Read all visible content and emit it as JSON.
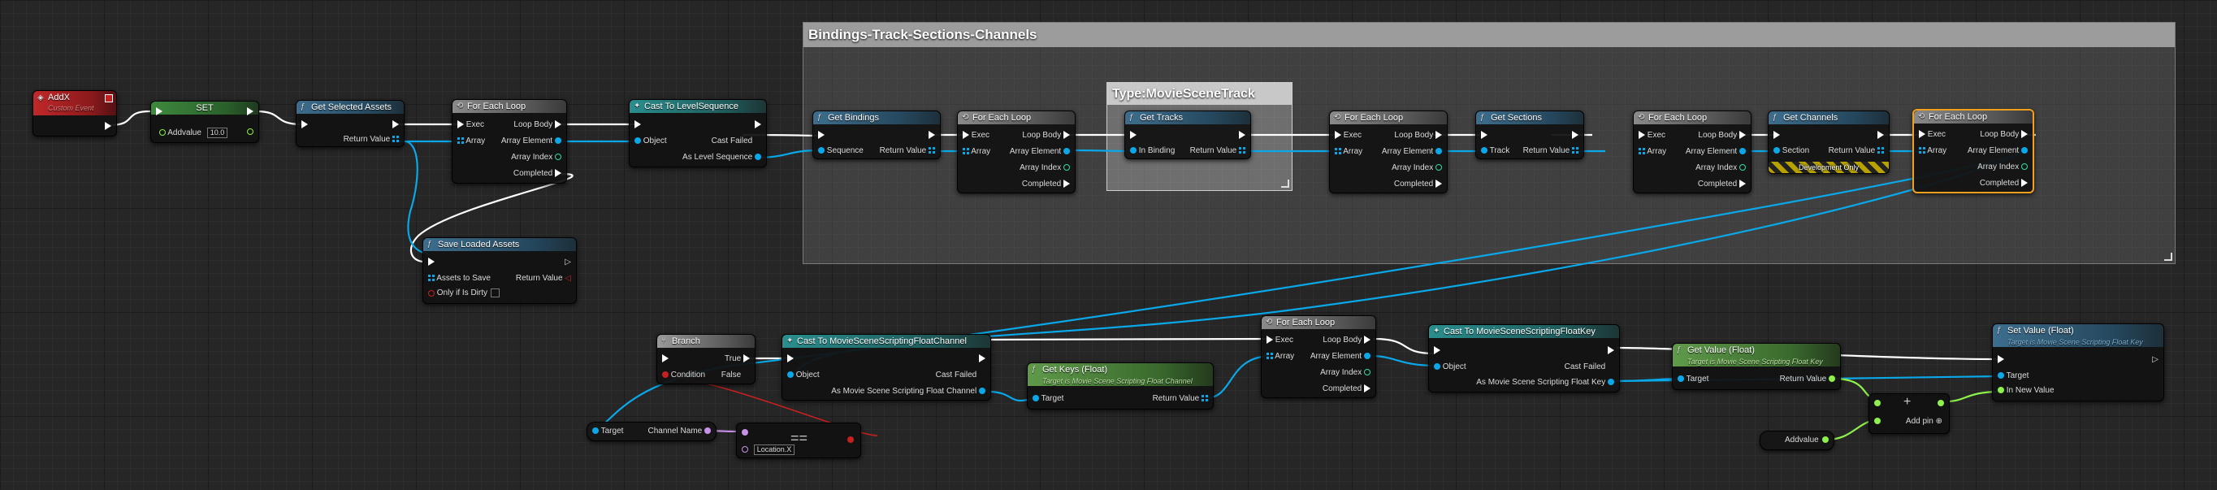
{
  "comments": {
    "main_title": "Bindings-Track-Sections-Channels",
    "inner_title": "Type:MovieSceneTrack"
  },
  "nodes": {
    "addx": {
      "title": "AddX",
      "subtitle": "Custom Event"
    },
    "set": {
      "title": "SET",
      "pin": "Addvalue",
      "value": "10.0"
    },
    "get_selected": {
      "title": "Get Selected Assets",
      "ret": "Return Value"
    },
    "loop1": {
      "title": "For Each Loop",
      "exec": "Exec",
      "array": "Array",
      "body": "Loop Body",
      "elem": "Array Element",
      "idx": "Array Index",
      "done": "Completed"
    },
    "cast_seq": {
      "title": "Cast To LevelSequence",
      "obj": "Object",
      "failed": "Cast Failed",
      "as": "As Level Sequence"
    },
    "save": {
      "title": "Save Loaded Assets",
      "assets": "Assets to Save",
      "ret": "Return Value",
      "dirty": "Only if Is Dirty"
    },
    "get_bindings": {
      "title": "Get Bindings",
      "in": "Sequence",
      "ret": "Return Value"
    },
    "loop2": {
      "title": "For Each Loop",
      "exec": "Exec",
      "array": "Array",
      "body": "Loop Body",
      "elem": "Array Element",
      "idx": "Array Index",
      "done": "Completed"
    },
    "get_tracks": {
      "title": "Get Tracks",
      "in": "In Binding",
      "ret": "Return Value"
    },
    "loop3": {
      "title": "For Each Loop",
      "exec": "Exec",
      "array": "Array",
      "body": "Loop Body",
      "elem": "Array Element",
      "idx": "Array Index",
      "done": "Completed"
    },
    "get_sections": {
      "title": "Get Sections",
      "in": "Track",
      "ret": "Return Value"
    },
    "loop4": {
      "title": "For Each Loop",
      "exec": "Exec",
      "array": "Array",
      "body": "Loop Body",
      "elem": "Array Element",
      "idx": "Array Index",
      "done": "Completed"
    },
    "get_channels": {
      "title": "Get Channels",
      "in": "Section",
      "ret": "Return Value",
      "dev": "Development Only"
    },
    "loop5": {
      "title": "For Each Loop",
      "exec": "Exec",
      "array": "Array",
      "body": "Loop Body",
      "elem": "Array Element",
      "idx": "Array Index",
      "done": "Completed"
    },
    "branch": {
      "title": "Branch",
      "cond": "Condition",
      "t": "True",
      "f": "False"
    },
    "cast_float_ch": {
      "title": "Cast To MovieSceneScriptingFloatChannel",
      "obj": "Object",
      "failed": "Cast Failed",
      "as": "As Movie Scene Scripting Float Channel"
    },
    "get_keys": {
      "title": "Get Keys (Float)",
      "subtitle": "Target is Movie Scene Scripting Float Channel",
      "target": "Target",
      "ret": "Return Value"
    },
    "loop6": {
      "title": "For Each Loop",
      "exec": "Exec",
      "array": "Array",
      "body": "Loop Body",
      "elem": "Array Element",
      "idx": "Array Index",
      "done": "Completed"
    },
    "cast_float_key": {
      "title": "Cast To MovieSceneScriptingFloatKey",
      "obj": "Object",
      "failed": "Cast Failed",
      "as": "As Movie Scene Scripting Float Key"
    },
    "get_value": {
      "title": "Get Value (Float)",
      "subtitle": "Target is Movie Scene Scripting Float Key",
      "target": "Target",
      "ret": "Return Value"
    },
    "set_value": {
      "title": "Set Value (Float)",
      "subtitle": "Target is Movie Scene Scripting Float Key",
      "target": "Target",
      "newval": "In New Value"
    },
    "channel_name": {
      "target": "Target",
      "ret": "Channel Name"
    },
    "equals": {
      "symbol": "==",
      "value": "Location.X"
    },
    "addvalue": {
      "label": "Addvalue"
    },
    "add": {
      "symbol": "+",
      "addpin": "Add pin",
      "addpin_icon": "⊕"
    }
  },
  "colors": {
    "exec": "#ffffff",
    "object": "#0aa8e8",
    "float": "#8ef04a",
    "bool": "#c82020",
    "name": "#c990e8",
    "selection": "#f4a01c"
  }
}
